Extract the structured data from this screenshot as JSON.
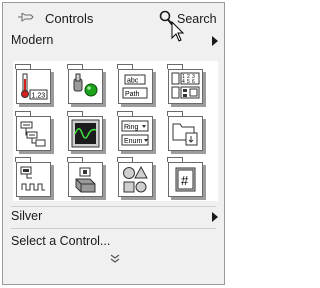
{
  "palette": {
    "title": "Controls",
    "search_label": "Search",
    "categories": [
      {
        "label": "Modern",
        "expanded": true
      },
      {
        "label": "Silver",
        "expanded": false
      }
    ],
    "select_control_label": "Select a Control...",
    "tiles": [
      {
        "name": "numeric-tile",
        "icon": "numeric-icon"
      },
      {
        "name": "boolean-tile",
        "icon": "boolean-icon"
      },
      {
        "name": "string-path-tile",
        "icon": "string-path-icon"
      },
      {
        "name": "array-matrix-cluster-tile",
        "icon": "array-icon"
      },
      {
        "name": "list-table-tree-tile",
        "icon": "tree-icon"
      },
      {
        "name": "graph-tile",
        "icon": "graph-icon"
      },
      {
        "name": "ring-enum-tile",
        "icon": "ring-enum-icon"
      },
      {
        "name": "containers-tile",
        "icon": "folder-icon"
      },
      {
        "name": "io-tile",
        "icon": "io-icon"
      },
      {
        "name": "variant-class-tile",
        "icon": "variant-icon"
      },
      {
        "name": "decorations-tile",
        "icon": "shapes-icon"
      },
      {
        "name": "refnum-tile",
        "icon": "refnum-icon"
      }
    ],
    "texts": {
      "string_tile_abc": "abc",
      "string_tile_path": "Path",
      "numeric_tile_value": "1.23",
      "ring_tile_ring": "Ring",
      "ring_tile_enum": "Enum",
      "array_tile_digits": [
        "1",
        "2",
        "3",
        "4",
        "5",
        "6"
      ],
      "refnum_tile_hash": "#"
    }
  }
}
